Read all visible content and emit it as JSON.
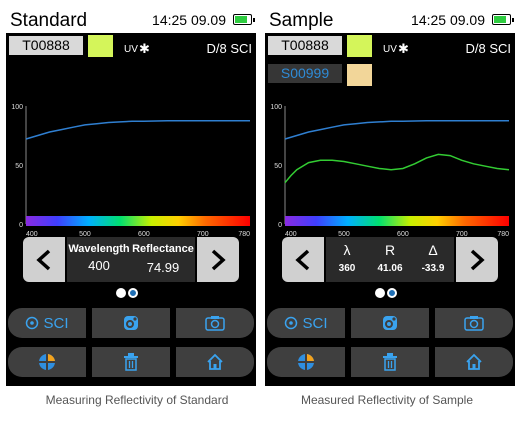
{
  "panels": [
    {
      "title": "Standard",
      "time": "14:25 09.09",
      "standard_id": "T00888",
      "sample_id": null,
      "standard_swatch": "#d4f55a",
      "sample_swatch": null,
      "uv_label": "UV",
      "geometry": "D/8 SCI",
      "info_mode": "labels",
      "wavelength_label": "Wavelength",
      "wavelength_value": "400",
      "reflectance_label": "Reflectance",
      "reflectance_value": "74.99",
      "buttons_row1": [
        "SCI",
        "",
        ""
      ],
      "caption": "Measuring Reflectivity of Standard"
    },
    {
      "title": "Sample",
      "time": "14:25 09.09",
      "standard_id": "T00888",
      "sample_id": "S00999",
      "standard_swatch": "#d4f55a",
      "sample_swatch": "#f2d699",
      "uv_label": "UV",
      "geometry": "D/8 SCI",
      "info_mode": "symbols",
      "lambda_symbol": "λ",
      "lambda_value": "360",
      "r_symbol": "R",
      "r_value": "41.06",
      "delta_symbol": "Δ",
      "delta_value": "-33.9",
      "buttons_row1": [
        "SCI",
        "",
        ""
      ],
      "caption": "Measured Reflectivity of Sample"
    }
  ],
  "chart_data": [
    {
      "type": "line",
      "x_ticks": [
        "400",
        "500",
        "600",
        "700",
        "780"
      ],
      "y_ticks": [
        "0",
        "50",
        "100"
      ],
      "xlim": [
        400,
        780
      ],
      "ylim": [
        0,
        100
      ],
      "series": [
        {
          "color": "#2f7fd1",
          "x": [
            400,
            420,
            440,
            460,
            480,
            500,
            520,
            540,
            560,
            580,
            600,
            640,
            700,
            740,
            780
          ],
          "y": [
            72,
            75,
            78,
            80,
            82,
            84,
            85,
            86,
            86.5,
            87,
            87,
            87.5,
            87.5,
            87.5,
            87.5
          ]
        }
      ]
    },
    {
      "type": "line",
      "x_ticks": [
        "400",
        "500",
        "600",
        "700",
        "780"
      ],
      "y_ticks": [
        "0",
        "50",
        "100"
      ],
      "xlim": [
        400,
        780
      ],
      "ylim": [
        0,
        100
      ],
      "series": [
        {
          "color": "#2f7fd1",
          "x": [
            400,
            420,
            440,
            460,
            480,
            500,
            520,
            540,
            560,
            580,
            600,
            640,
            700,
            740,
            780
          ],
          "y": [
            72,
            75,
            78,
            80,
            82,
            84,
            85,
            86,
            86.5,
            87,
            87,
            87.5,
            87.5,
            87.5,
            87.5
          ]
        },
        {
          "color": "#33cc33",
          "x": [
            400,
            410,
            420,
            440,
            460,
            480,
            500,
            520,
            540,
            560,
            580,
            600,
            620,
            640,
            660,
            680,
            700,
            720,
            740,
            760,
            780
          ],
          "y": [
            35,
            41,
            46,
            52,
            54,
            54,
            53,
            51,
            49,
            47,
            46,
            47,
            51,
            56,
            59,
            58,
            54,
            51,
            49,
            47,
            46
          ]
        }
      ]
    }
  ]
}
